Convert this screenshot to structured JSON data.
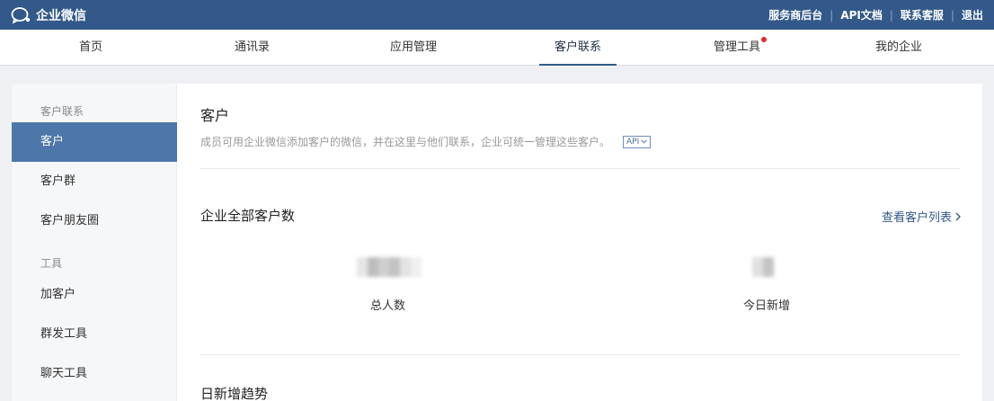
{
  "app": {
    "name": "企业微信"
  },
  "toplinks": [
    "服务商后台",
    "API文档",
    "联系客服",
    "退出"
  ],
  "nav": {
    "items": [
      {
        "label": "首页"
      },
      {
        "label": "通讯录"
      },
      {
        "label": "应用管理"
      },
      {
        "label": "客户联系",
        "active": true
      },
      {
        "label": "管理工具",
        "badge": true
      },
      {
        "label": "我的企业"
      }
    ]
  },
  "sidebar": {
    "group1": "客户联系",
    "items1": [
      "客户",
      "客户群",
      "客户朋友圈"
    ],
    "group2": "工具",
    "items2": [
      "加客户",
      "群发工具",
      "聊天工具"
    ]
  },
  "main": {
    "title": "客户",
    "description": "成员可用企业微信添加客户的微信，并在这里与他们联系，企业可统一管理这些客户。",
    "api_tag": "API",
    "section_customers": "企业全部客户数",
    "view_list": "查看客户列表",
    "stats": [
      {
        "label": "总人数"
      },
      {
        "label": "今日新增"
      }
    ],
    "section_trend": "日新增趋势"
  },
  "colors": {
    "header": "#325989",
    "active_side": "#4d77a9",
    "badge": "#e42b2b"
  }
}
